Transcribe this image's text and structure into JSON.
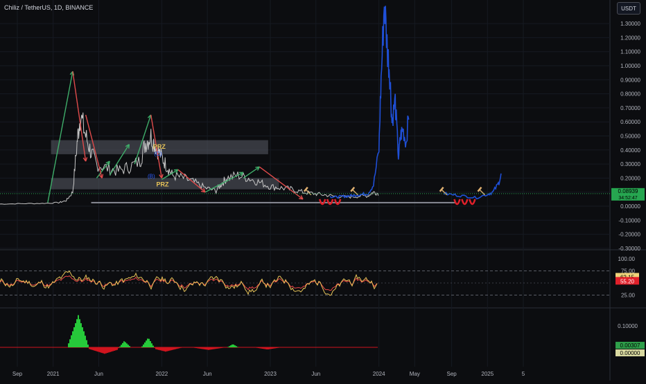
{
  "header": {
    "symbol": "Chiliz / TetherUS, 1D, BINANCE",
    "currency": "USDT"
  },
  "colors": {
    "background": "#0c0d10",
    "up_wave": "#3fae6a",
    "down_wave": "#e04b4b",
    "projection": "#1f4fd6",
    "price_line": "#c8c8c8",
    "zone_fill": "#5a5d66",
    "rsi_line": "#e8c458",
    "rsi_slow": "#e84646",
    "hist_pos": "#26c93a",
    "hist_neg": "#d0141e",
    "price_badge": "#26a650",
    "rsi_badge_1": "#efd37a",
    "rsi_badge_2": "#e0202a",
    "hist_badge": "#2e9f4a",
    "hist_badge_2": "#d9d9a0"
  },
  "chart_data": [
    {
      "type": "line",
      "panel": "price",
      "title": "Chiliz / TetherUS, 1D, BINANCE",
      "y_ticks": [
        "1.30000",
        "1.20000",
        "1.10000",
        "1.00000",
        "0.90000",
        "0.80000",
        "0.70000",
        "0.60000",
        "0.50000",
        "0.40000",
        "0.30000",
        "0.20000",
        "0.10000",
        "0.00000",
        "-0.10000",
        "-0.20000",
        "-0.30000"
      ],
      "ylim": [
        -0.3,
        1.45
      ],
      "x_ticks": [
        "Sep",
        "2021",
        "Jun",
        "2022",
        "Jun",
        "2023",
        "Jun",
        "2024",
        "May",
        "Sep",
        "2025",
        "5"
      ],
      "current_price_label": "0.08939",
      "countdown_label": "34:52:47",
      "annotations": [
        "PRZ",
        "(C)",
        "(B)",
        "PRZ"
      ],
      "zones": [
        {
          "x": [
            2020.98,
            2022.98
          ],
          "y": [
            0.37,
            0.47
          ]
        },
        {
          "x": [
            2020.98,
            2023.08
          ],
          "y": [
            0.12,
            0.2
          ]
        }
      ],
      "support_line": {
        "x": [
          2021.35,
          2024.7
        ],
        "y": 0.025
      },
      "price_series": {
        "x": [
          2020.5,
          2020.7,
          2020.9,
          2021.05,
          2021.12,
          2021.18,
          2021.22,
          2021.25,
          2021.3,
          2021.35,
          2021.4,
          2021.5,
          2021.6,
          2021.7,
          2021.8,
          2021.85,
          2021.9,
          2021.95,
          2022.0,
          2022.05,
          2022.1,
          2022.2,
          2022.3,
          2022.4,
          2022.5,
          2022.55,
          2022.6,
          2022.7,
          2022.8,
          2022.9,
          2023.0,
          2023.1,
          2023.2,
          2023.3,
          2023.4,
          2023.5,
          2023.6,
          2023.7,
          2023.8,
          2023.9,
          2023.95,
          2024.0
        ],
        "y": [
          0.015,
          0.018,
          0.02,
          0.025,
          0.04,
          0.1,
          0.45,
          0.65,
          0.5,
          0.38,
          0.3,
          0.27,
          0.25,
          0.28,
          0.32,
          0.45,
          0.5,
          0.42,
          0.35,
          0.28,
          0.22,
          0.2,
          0.17,
          0.13,
          0.11,
          0.16,
          0.2,
          0.22,
          0.2,
          0.17,
          0.14,
          0.13,
          0.12,
          0.1,
          0.09,
          0.08,
          0.07,
          0.065,
          0.07,
          0.075,
          0.1,
          0.09
        ]
      },
      "wave_up": [
        {
          "x": [
            2020.95,
            2021.18
          ],
          "y": [
            0.025,
            0.96
          ]
        },
        {
          "x": [
            2021.4,
            2021.52
          ],
          "y": [
            0.2,
            0.32
          ]
        },
        {
          "x": [
            2021.52,
            2021.7
          ],
          "y": [
            0.22,
            0.44
          ]
        },
        {
          "x": [
            2021.75,
            2021.9
          ],
          "y": [
            0.3,
            0.65
          ]
        },
        {
          "x": [
            2022.0,
            2022.15
          ],
          "y": [
            0.19,
            0.26
          ]
        },
        {
          "x": [
            2022.4,
            2022.75
          ],
          "y": [
            0.1,
            0.24
          ]
        },
        {
          "x": [
            2022.75,
            2022.9
          ],
          "y": [
            0.2,
            0.28
          ]
        }
      ],
      "wave_down": [
        {
          "x": [
            2021.18,
            2021.3
          ],
          "y": [
            0.96,
            0.32
          ]
        },
        {
          "x": [
            2021.3,
            2021.45
          ],
          "y": [
            0.65,
            0.2
          ]
        },
        {
          "x": [
            2021.9,
            2022.0
          ],
          "y": [
            0.65,
            0.2
          ]
        },
        {
          "x": [
            2022.15,
            2022.4
          ],
          "y": [
            0.26,
            0.1
          ]
        },
        {
          "x": [
            2022.9,
            2023.3
          ],
          "y": [
            0.28,
            0.05
          ]
        }
      ],
      "projection_1": {
        "x": [
          2023.55,
          2023.6,
          2023.65,
          2023.7,
          2023.75,
          2023.8,
          2023.85,
          2023.9,
          2023.95,
          2024.0,
          2024.02,
          2024.05,
          2024.08,
          2024.1,
          2024.12,
          2024.15,
          2024.18,
          2024.2,
          2024.22,
          2024.25,
          2024.28
        ],
        "y": [
          0.07,
          0.065,
          0.068,
          0.072,
          0.075,
          0.08,
          0.085,
          0.09,
          0.15,
          0.4,
          0.9,
          1.45,
          1.1,
          0.95,
          0.6,
          0.75,
          0.35,
          0.5,
          0.55,
          0.45,
          0.7
        ]
      },
      "projection_2": {
        "x": [
          2024.6,
          2024.7,
          2024.8,
          2024.9,
          2025.0,
          2025.05,
          2025.1,
          2025.13
        ],
        "y": [
          0.09,
          0.08,
          0.07,
          0.06,
          0.085,
          0.1,
          0.16,
          0.23
        ]
      }
    },
    {
      "type": "line",
      "panel": "rsi",
      "y_ticks": [
        "100.00",
        "75.00",
        "25.00"
      ],
      "ylim": [
        0,
        100
      ],
      "bands": [
        75,
        25
      ],
      "value_labels": [
        "62.15",
        "55.20"
      ]
    },
    {
      "type": "bar",
      "panel": "histogram",
      "y_ticks": [
        "0.10000"
      ],
      "ylim": [
        -0.03,
        0.18
      ],
      "value_labels": [
        "0.00307",
        "0.00000"
      ]
    }
  ]
}
